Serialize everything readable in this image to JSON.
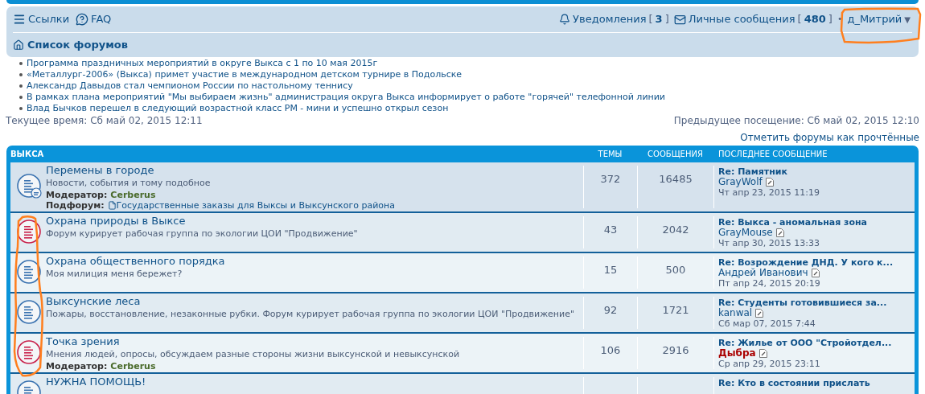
{
  "navbar": {
    "links": [
      {
        "kind": "menu",
        "label": "Ссылки"
      },
      {
        "kind": "faq",
        "label": "FAQ"
      }
    ],
    "notifications": {
      "label": "Уведомления",
      "open": "[",
      "count": "3",
      "close": "]"
    },
    "messages": {
      "label": "Личные сообщения",
      "open": "[",
      "count": "480",
      "close": "]"
    },
    "separator": "•",
    "user": {
      "name": "д_Митрий",
      "caret": "▼"
    },
    "breadcrumb": "Список форумов"
  },
  "news": [
    "Программа праздничных мероприятий в округе Выкса с 1 по 10 мая 2015г",
    "«Металлург-2006» (Выкса) примет участие в международном детском турнире в Подольске",
    "Александр Давыдов стал чемпионом России по настольному теннису",
    "В рамках плана мероприятий \"Мы выбираем жизнь\" администрация округа Выкса информирует о работе \"горячей\" телефонной линии",
    "Влад Бычков перешел в следующий возрастной класс РМ - мини и успешно открыл сезон"
  ],
  "current_time": "Текущее время: Сб май 02, 2015 12:11",
  "last_visit": "Предыдущее посещение: Сб май 02, 2015 12:10",
  "mark_read": "Отметить форумы как прочтённые",
  "forum_table": {
    "columns": [
      "ВЫКСА",
      "ТЕМЫ",
      "СООБЩЕНИЯ",
      "ПОСЛЕДНЕЕ СООБЩЕНИЕ"
    ],
    "rows": [
      {
        "title": "Перемены в городе",
        "description": "Новости, события и тому подобное",
        "moderator_label": "Модератор:",
        "moderator": "Cerberus",
        "subforum_label": "Подфорум:",
        "subforum": "Государственные заказы для Выксы и Выксунского района",
        "unread": false,
        "topics": "372",
        "posts": "16485",
        "last_title": "Re: Памятник",
        "last_author": "GrayWolf",
        "color": "#105289",
        "last_date": "Чт апр 23, 2015 11:19"
      },
      {
        "title": "Охрана природы в Выксе",
        "description": "Форум курирует рабочая группа по экологии ЦОИ \"Продвижение\"",
        "unread": true,
        "topics": "43",
        "posts": "2042",
        "last_title": "Re: Выкса - аномальная зона",
        "last_author": "GrayMouse",
        "color": "#105289",
        "last_date": "Чт апр 30, 2015 13:33"
      },
      {
        "title": "Охрана общественного порядка",
        "description": "Моя милиция меня бережет?",
        "unread": false,
        "topics": "15",
        "posts": "500",
        "last_title": "Re: Возрождение ДНД. У кого к...",
        "last_author": "Андрей Иванович",
        "color": "#105289",
        "last_date": "Пт апр 24, 2015 20:19"
      },
      {
        "title": "Выксунские леса",
        "description": "Пожары, восстановление, незаконные рубки. Форум курирует рабочая группа по экологии ЦОИ \"Продвижение\"",
        "unread": false,
        "topics": "92",
        "posts": "1721",
        "last_title": "Re: Студенты готовившиеся за...",
        "last_author": "kanwal",
        "color": "#105289",
        "last_date": "Сб мар 07, 2015 7:44"
      },
      {
        "title": "Точка зрения",
        "description": "Мнения людей, опросы, обсуждаем разные стороны жизни выксунской и невыксунской",
        "moderator_label": "Модератор:",
        "moderator": "Cerberus",
        "unread": true,
        "topics": "106",
        "posts": "2916",
        "last_title": "Re: Жилье от ООО \"Стройотдел...",
        "last_author": "Дыбра",
        "color": "#aa0000",
        "last_date": "Ср апр 29, 2015 23:11"
      },
      {
        "title": "НУЖНА ПОМОЩЬ!",
        "unread": false,
        "last_title": "Re: Кто в состоянии прислать"
      }
    ]
  }
}
